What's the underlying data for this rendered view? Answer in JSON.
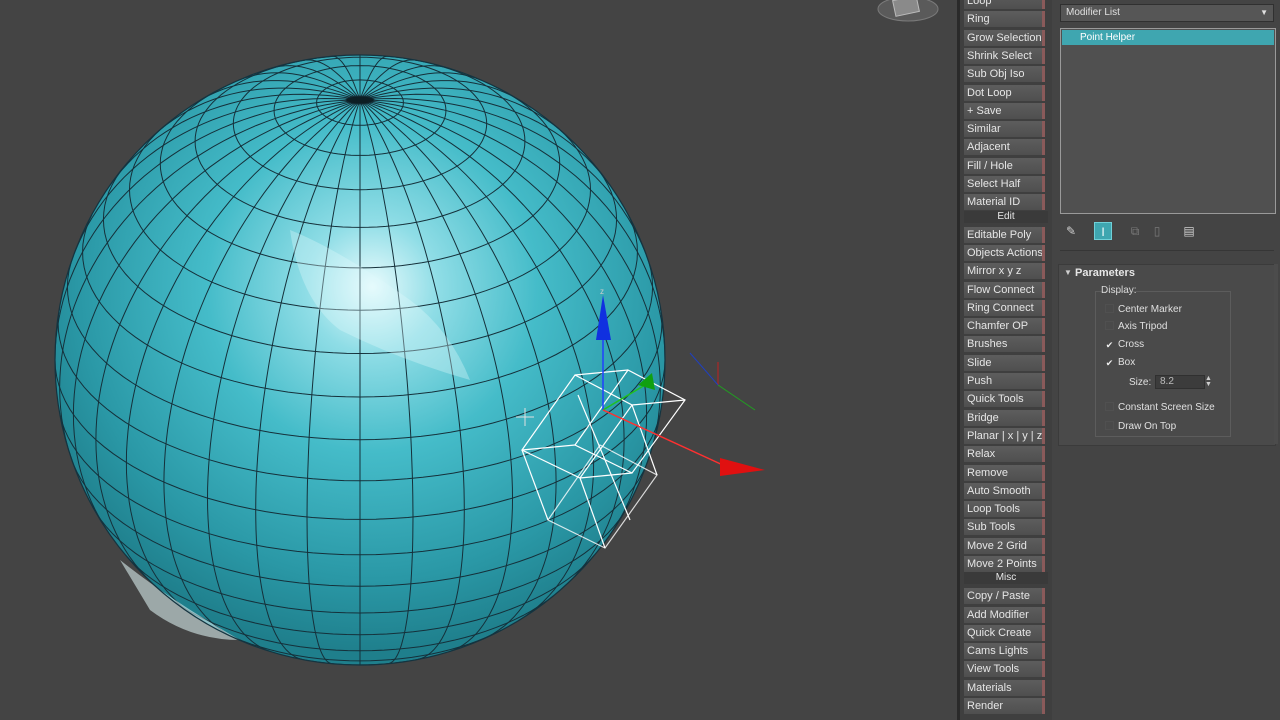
{
  "toolbar": {
    "buttons": [
      {
        "label": "Loop"
      },
      {
        "label": "Ring"
      },
      {
        "label": "Grow Selection"
      },
      {
        "label": "Shrink Select"
      },
      {
        "label": "Sub Obj Iso"
      },
      {
        "label": "Dot Loop"
      },
      {
        "label": "+ Save"
      },
      {
        "label": "Similar"
      },
      {
        "label": "Adjacent"
      },
      {
        "label": "Fill / Hole"
      },
      {
        "label": "Select Half"
      },
      {
        "label": "Material ID"
      },
      {
        "label": "Editable Poly"
      },
      {
        "label": "Objects Actions"
      },
      {
        "label": "Mirror   x  y  z"
      },
      {
        "label": "Flow Connect"
      },
      {
        "label": "Ring Connect"
      },
      {
        "label": "Chamfer OP"
      },
      {
        "label": "Brushes"
      },
      {
        "label": "Slide"
      },
      {
        "label": "Push"
      },
      {
        "label": "Quick Tools"
      },
      {
        "label": "Bridge"
      },
      {
        "label": "Planar | x | y | z"
      },
      {
        "label": "Relax"
      },
      {
        "label": "Remove"
      },
      {
        "label": "Auto Smooth"
      },
      {
        "label": "Loop Tools"
      },
      {
        "label": "Sub Tools"
      },
      {
        "label": "Move 2 Grid"
      },
      {
        "label": "Move 2 Points"
      },
      {
        "label": "Copy / Paste"
      },
      {
        "label": "Add Modifier"
      },
      {
        "label": "Quick Create"
      },
      {
        "label": "Cams Lights"
      },
      {
        "label": "View Tools"
      },
      {
        "label": "Materials"
      },
      {
        "label": "Render"
      }
    ],
    "sections": {
      "edit": "Edit",
      "misc": "Misc"
    }
  },
  "command_panel": {
    "modifier_list": "Modifier List",
    "stack_item": "Point Helper",
    "parameters": {
      "title": "Parameters",
      "display_label": "Display:",
      "center_marker": {
        "label": "Center Marker",
        "checked": false
      },
      "axis_tripod": {
        "label": "Axis Tripod",
        "checked": false
      },
      "cross": {
        "label": "Cross",
        "checked": true
      },
      "box": {
        "label": "Box",
        "checked": true
      },
      "size_label": "Size:",
      "size_value": "8.2",
      "constant_screen_size": {
        "label": "Constant Screen Size",
        "checked": false
      },
      "draw_on_top": {
        "label": "Draw On Top",
        "checked": false
      }
    }
  },
  "colors": {
    "viewport_bg": "#444444",
    "sphere": "#3fb6c4",
    "wire": "#15303a",
    "accent": "#3fa6b0",
    "gizmo_x": "#e01010",
    "gizmo_y": "#10a010",
    "gizmo_z": "#1030e0"
  }
}
